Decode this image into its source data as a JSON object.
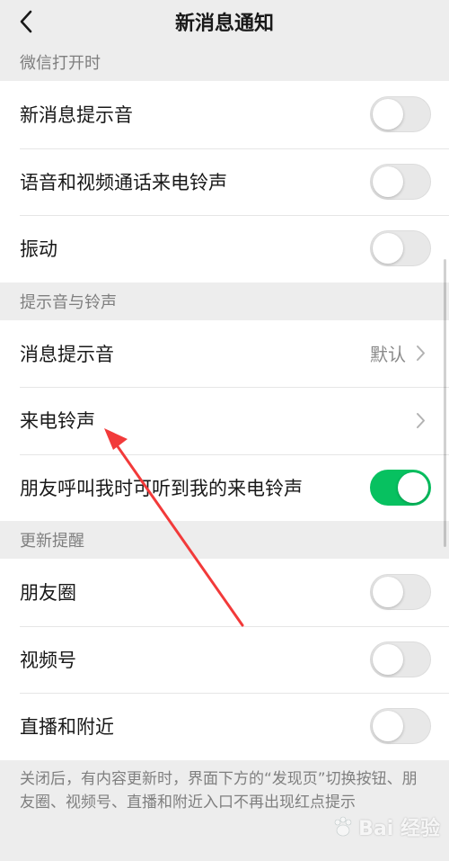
{
  "header": {
    "title": "新消息通知"
  },
  "sections": [
    {
      "title": "微信打开时",
      "rows": [
        {
          "label": "新消息提示音",
          "toggle": false
        },
        {
          "label": "语音和视频通话来电铃声",
          "toggle": false
        },
        {
          "label": "振动",
          "toggle": false
        }
      ]
    },
    {
      "title": "提示音与铃声",
      "rows": [
        {
          "label": "消息提示音",
          "value": "默认",
          "chevron": true
        },
        {
          "label": "来电铃声",
          "chevron": true
        },
        {
          "label": "朋友呼叫我时可听到我的来电铃声",
          "toggle": true
        }
      ]
    },
    {
      "title": "更新提醒",
      "rows": [
        {
          "label": "朋友圈",
          "toggle": false
        },
        {
          "label": "视频号",
          "toggle": false
        },
        {
          "label": "直播和附近",
          "toggle": false
        }
      ]
    }
  ],
  "footnote": "关闭后，有内容更新时，界面下方的“发现页”切换按钮、朋友圈、视频号、直播和附近入口不再出现红点提示",
  "watermark": {
    "text": "Bai 经验"
  },
  "colors": {
    "accent": "#07c160",
    "annotation_arrow": "#f23a3a",
    "background": "#ededed",
    "cell": "#ffffff"
  },
  "icons": {
    "back": "chevron-left-icon",
    "row_arrow": "chevron-right-icon"
  }
}
